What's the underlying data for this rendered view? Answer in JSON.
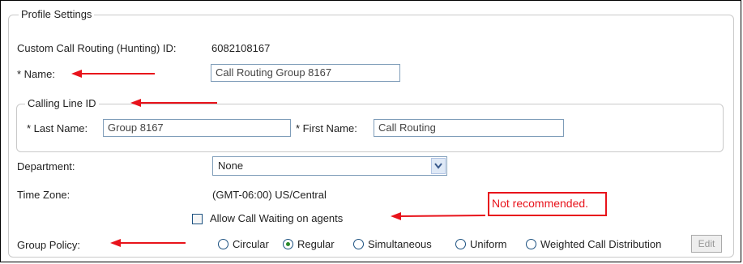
{
  "profile_settings": {
    "legend": "Profile Settings",
    "hunting_id_label": "Custom Call Routing (Hunting) ID:",
    "hunting_id_value": "6082108167",
    "name_label": "* Name:",
    "name_value": "Call Routing Group 8167"
  },
  "calling_line_id": {
    "legend": "Calling Line ID",
    "last_name_label": "* Last Name:",
    "last_name_value": "Group 8167",
    "first_name_label": "* First Name:",
    "first_name_value": "Call Routing"
  },
  "department": {
    "label": "Department:",
    "selected": "None"
  },
  "time_zone": {
    "label": "Time Zone:",
    "value": "(GMT-06:00) US/Central"
  },
  "call_waiting": {
    "label": "Allow Call Waiting on agents",
    "checked": false
  },
  "annotation": {
    "text": "Not recommended.",
    "color": "#e8131b"
  },
  "group_policy": {
    "label": "Group Policy:",
    "options": [
      "Circular",
      "Regular",
      "Simultaneous",
      "Uniform",
      "Weighted Call Distribution"
    ],
    "selected": "Regular",
    "edit_label": "Edit"
  },
  "colors": {
    "accent_arrow": "#e8131b",
    "input_border": "#7f9db9",
    "fieldset_border": "#c9c9c9"
  }
}
